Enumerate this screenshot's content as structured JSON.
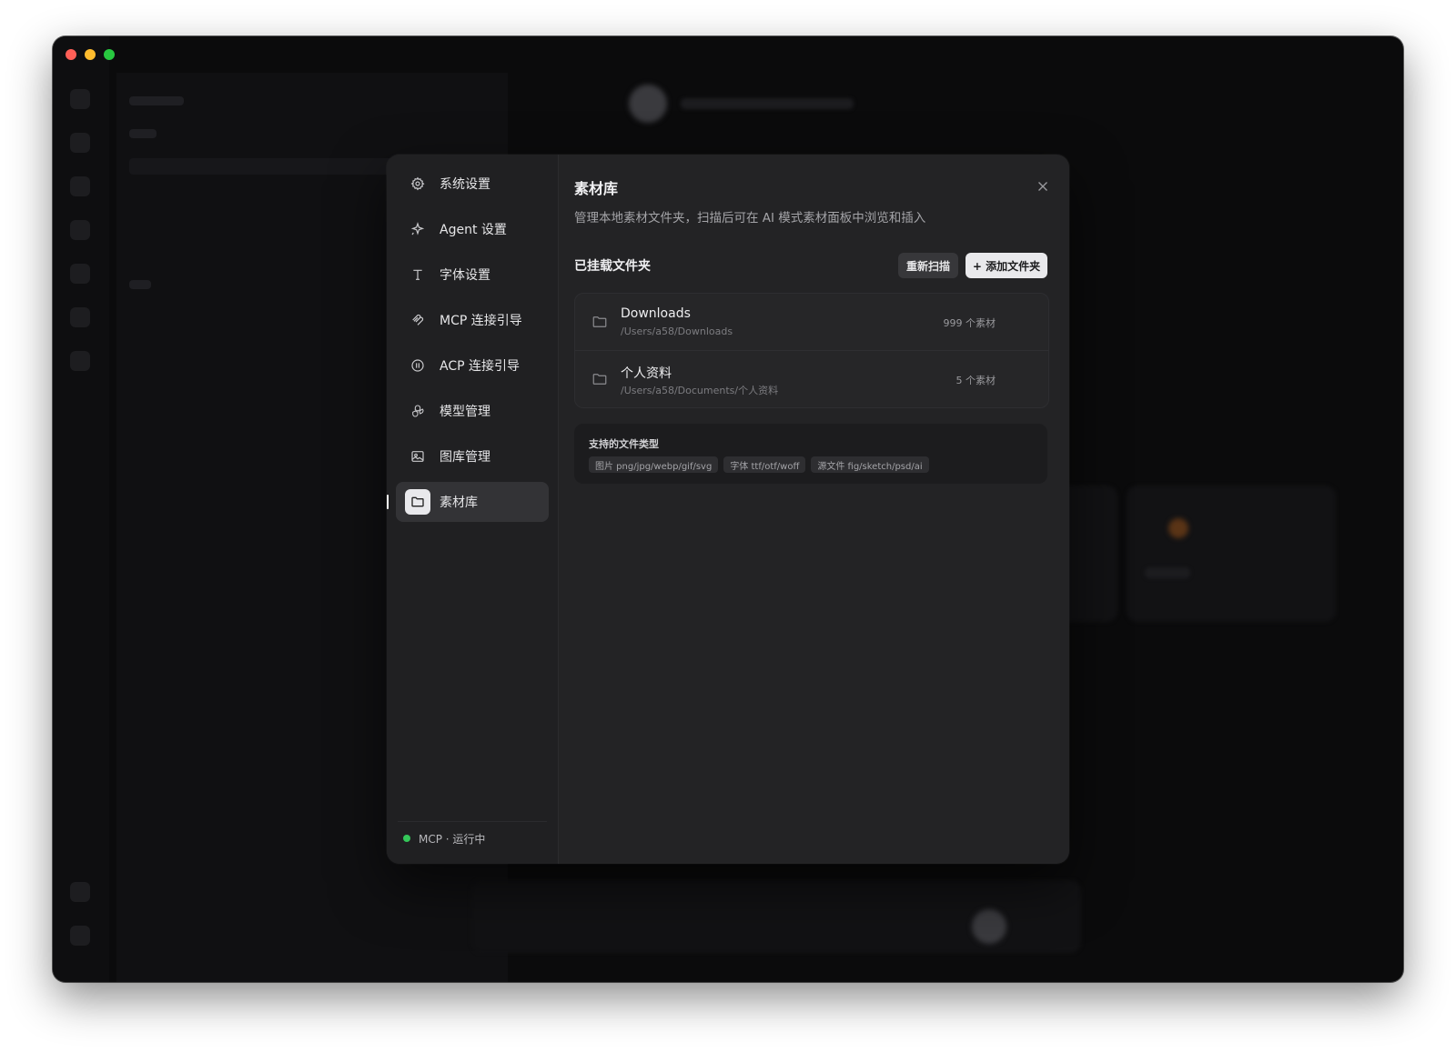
{
  "modal": {
    "nav": [
      {
        "label": "系统设置",
        "icon": "gear-icon"
      },
      {
        "label": "Agent 设置",
        "icon": "sparkle-icon"
      },
      {
        "label": "字体设置",
        "icon": "type-icon"
      },
      {
        "label": "MCP 连接引导",
        "icon": "mcp-icon"
      },
      {
        "label": "ACP 连接引导",
        "icon": "acp-icon"
      },
      {
        "label": "模型管理",
        "icon": "openai-icon"
      },
      {
        "label": "图库管理",
        "icon": "image-icon"
      },
      {
        "label": "素材库",
        "icon": "folder-icon",
        "active": true
      }
    ],
    "status": "MCP · 运行中",
    "status_color": "#34c759",
    "title": "素材库",
    "description": "管理本地素材文件夹，扫描后可在 AI 模式素材面板中浏览和插入",
    "section_title": "已挂载文件夹",
    "rescan_label": "重新扫描",
    "add_label": "+ 添加文件夹",
    "folders": [
      {
        "name": "Downloads",
        "path": "/Users/a58/Downloads",
        "count": "999 个素材"
      },
      {
        "name": "个人资料",
        "path": "/Users/a58/Documents/个人资料",
        "count": "5 个素材"
      }
    ],
    "types_title": "支持的文件类型",
    "types": [
      "图片 png/jpg/webp/gif/svg",
      "字体 ttf/otf/woff",
      "源文件 fig/sketch/psd/ai"
    ]
  }
}
